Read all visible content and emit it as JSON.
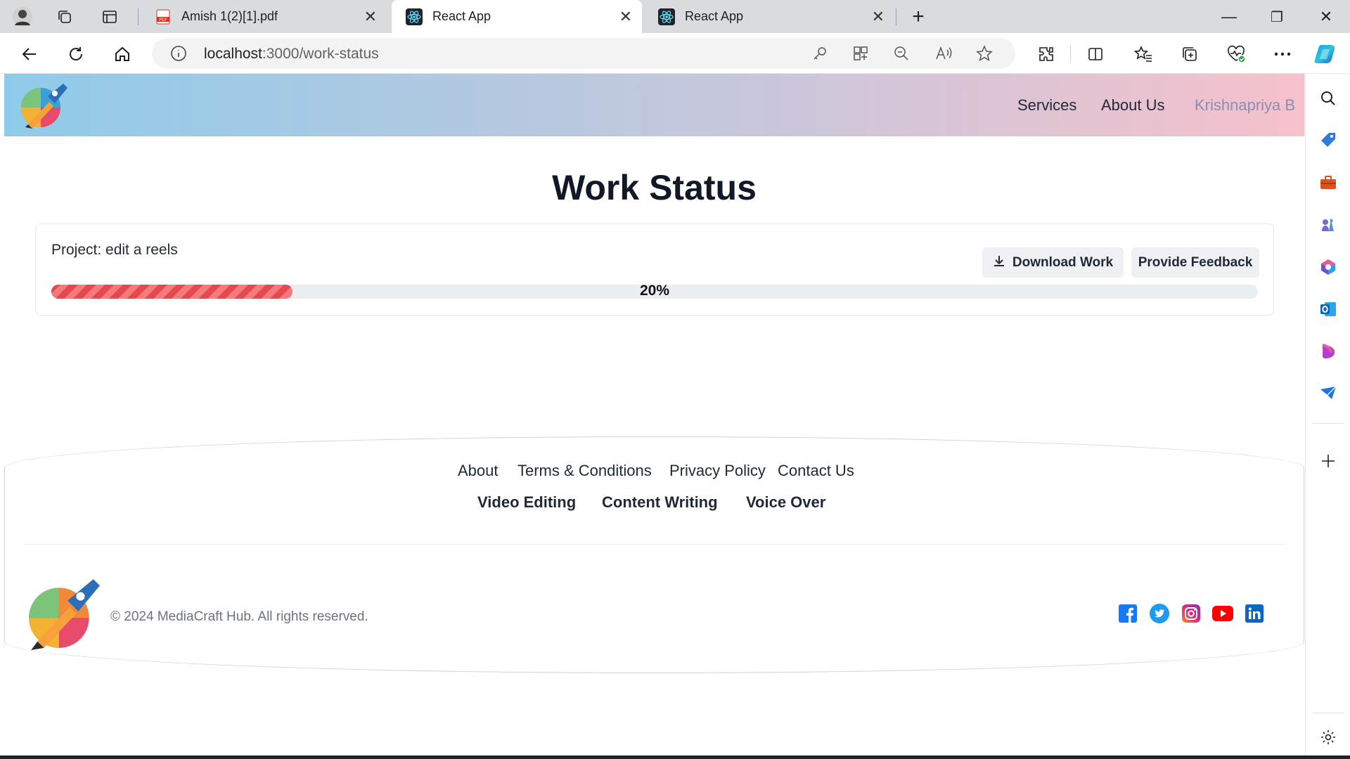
{
  "browser": {
    "tabs": [
      {
        "title": "Amish 1(2)[1].pdf",
        "favicon": "pdf-icon"
      },
      {
        "title": "React App",
        "favicon": "react-icon",
        "active": true
      },
      {
        "title": "React App",
        "favicon": "react-icon"
      }
    ],
    "url_host": "localhost",
    "url_path": ":3000/work-status",
    "close_glyph": "✕",
    "new_tab_glyph": "+",
    "window_controls": {
      "minimize": "—",
      "restore": "❐",
      "close": "✕"
    }
  },
  "header": {
    "nav": [
      "Services",
      "About Us"
    ],
    "user_name": "Krishnapriya B",
    "user_color": "#8a8fb3"
  },
  "main": {
    "title": "Work Status",
    "project_label": "Project: edit a reels",
    "download_label": "Download Work",
    "feedback_label": "Provide Feedback",
    "progress_percent": 20,
    "progress_text": "20%",
    "progress_color": "#e5484d"
  },
  "footer": {
    "links": [
      "About",
      "Terms & Conditions",
      "Privacy Policy",
      "Contact Us"
    ],
    "services": [
      "Video Editing",
      "Content Writing",
      "Voice Over"
    ],
    "copyright": "© 2024 MediaCraft Hub. All rights reserved.",
    "social": [
      "facebook-icon",
      "twitter-icon",
      "instagram-icon",
      "youtube-icon",
      "linkedin-icon"
    ]
  }
}
